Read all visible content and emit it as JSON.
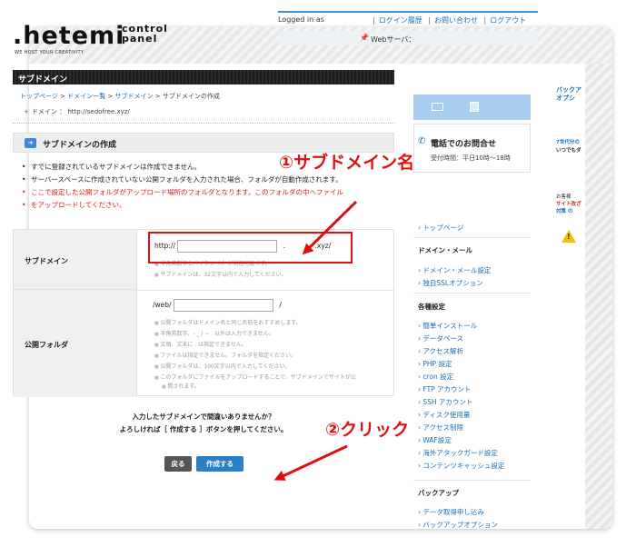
{
  "header": {
    "logo_main": ".hetemi",
    "logo_cp_line1": "control",
    "logo_cp_line2": "panel",
    "logo_tagline": "WE HOST YOUR CREATIVITY",
    "logged_in": "Logged in as",
    "links": [
      "ログイン履歴",
      "お問い合わせ",
      "ログアウト"
    ],
    "server_label": "Webサーバ："
  },
  "main": {
    "section_title": "サブドメイン",
    "breadcrumb": [
      "トップページ",
      "ドメイン一覧",
      "サブドメイン",
      "サブドメインの作成"
    ],
    "domain_line": "ドメイン ： http://sedofree.xyz/",
    "box_title": "サブドメインの作成",
    "notes": [
      "すでに登録されているサブドメインは作成できません。",
      "サーバースペースに作成されていない公開フォルダを入力された場合、フォルダが自動作成されます。",
      "ここで設定した公開フォルダがアップロード場所のフォルダとなります。このフォルダの中へファイル",
      "をアップロードしてください。"
    ],
    "form": {
      "subdomain_label": "サブドメイン",
      "subdomain_prefix": "http://",
      "subdomain_value": "",
      "subdomain_mid": ".",
      "subdomain_suffix": ".xyz/",
      "subdomain_hints": [
        "半角英数字とハイフン（-）が利用可能です。",
        "サブドメインは、32文字以内で入力してください。"
      ],
      "folder_label": "公開フォルダ",
      "folder_prefix": "/web/",
      "folder_value": "",
      "folder_suffix": "/",
      "folder_hints": [
        "公開フォルダはドメイン名と同じ名前をおすすめします。",
        "半角英数字、- _ / ~ . 以外は入力できません。",
        "文頭、文末に . は指定できません。",
        "ファイルは指定できません。フォルダを指定ください。",
        "公開フォルダは、100文字以内で入力してください。",
        "このフォルダにファイルをアップロードすることで、サブドメインでサイトが公",
        "開されます。"
      ]
    },
    "confirm_line1": "入力したサブドメインで間違いありませんか？",
    "confirm_line2": "よろしければ［ 作成する ］ボタンを押してください。",
    "back_button": "戻る",
    "create_button": "作成する"
  },
  "annotations": {
    "step1": "①サブドメイン名を入力",
    "step2": "②クリック",
    "color": "#e01010"
  },
  "sidebar": {
    "phone_title": "電話でのお問合せ",
    "phone_hours": "受付時間：平日10時〜18時",
    "top_link": "トップページ",
    "group1_title": "ドメイン・メール",
    "group1_items": [
      "ドメイン・メール設定",
      "独自SSLオプション"
    ],
    "group2_title": "各種設定",
    "group2_items": [
      "簡単インストール",
      "データベース",
      "アクセス解析",
      "PHP 設定",
      "cron 設定",
      "FTP アカウント",
      "SSH アカウント",
      "ディスク使用量",
      "アクセス制限",
      "WAF設定",
      "海外アタックガード設定",
      "コンテンツキャッシュ設定"
    ],
    "group3_title": "バックアップ",
    "group3_items": [
      "データ取得申し込み",
      "バックアップオプション"
    ]
  },
  "ad": {
    "line1": "バックア",
    "line2": "オプシ",
    "line3": "7世代分の",
    "line4": "いつでもダ",
    "line5": "お客様",
    "line6": "サイト改ざ",
    "line7": "対策 の"
  }
}
